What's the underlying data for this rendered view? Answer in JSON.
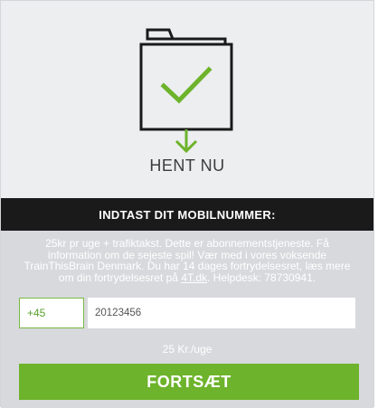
{
  "hero": {
    "icon": "folder-download-check-icon",
    "cta_label": "HENT NU"
  },
  "banner": {
    "title": "INDTAST DIT MOBILNUMMER:"
  },
  "info": {
    "text_before_link": "25kr pr uge + trafiktakst. Dette er abonnementstjeneste. Få information om de sejeste spil! Vær med i vores voksende TrainThisBrain Denmark. Du har 14 dages fortrydelsesret, læs mere om din fortrydelsesret på ",
    "link_text": "4T.dk",
    "text_after_link": ". Helpdesk: 78730941."
  },
  "phone": {
    "prefix": "+45",
    "value": "20123456",
    "placeholder": "20123456"
  },
  "price": "25 Kr./uge",
  "submit_label": "FORTSÆT",
  "colors": {
    "accent": "#6db32b",
    "icon_stroke": "#1a1a1a",
    "banner_bg": "#1a1a1a",
    "form_bg": "#d7d9dc",
    "hero_bg": "#eceef0"
  }
}
